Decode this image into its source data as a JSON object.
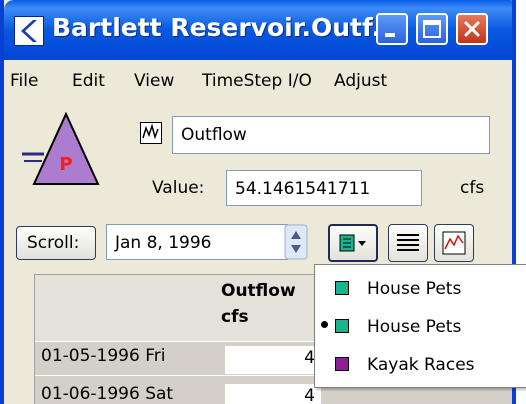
{
  "window": {
    "title": "Bartlett Reservoir.Outf...",
    "accent_color": "#0a5fe8",
    "controls": [
      "minimize-icon",
      "maximize-icon",
      "close-icon"
    ]
  },
  "menubar": {
    "items": [
      "File",
      "Edit",
      "View",
      "TimeStep I/O",
      "Adjust"
    ]
  },
  "object": {
    "icon": "reservoir-icon",
    "icon_letter": "P",
    "slot_icon": "series-slot-icon",
    "slot_name": "Outflow",
    "value_label": "Value:",
    "value": "54.1461541711",
    "units": "cfs"
  },
  "toolbar": {
    "scroll_label": "Scroll:",
    "date": "Jan 8, 1996",
    "list_button_icon": "list-dropdown-icon",
    "lines_icon": "text-lines-icon",
    "plot_icon": "plot-icon"
  },
  "table": {
    "header": [
      "Outflow",
      "cfs"
    ],
    "rows": [
      {
        "date": "01-05-1996 Fri",
        "value": "4"
      },
      {
        "date": "01-06-1996 Sat",
        "value": "4"
      }
    ]
  },
  "dropdown": {
    "items": [
      {
        "label": "House Pets",
        "color": "#19b38f",
        "selected": false
      },
      {
        "label": "House Pets",
        "color": "#19b38f",
        "selected": true
      },
      {
        "label": "Kayak Races",
        "color": "#8e1e93",
        "selected": false
      }
    ]
  }
}
